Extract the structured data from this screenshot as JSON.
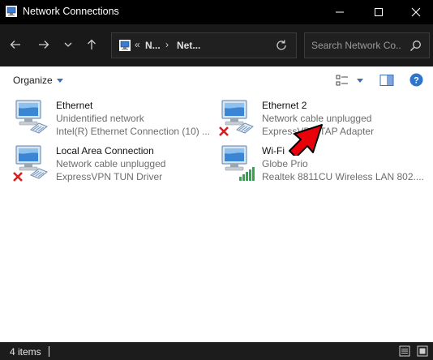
{
  "window": {
    "title": "Network Connections"
  },
  "address": {
    "crumb_overflow": "«",
    "crumbs": [
      "N...",
      "Net..."
    ],
    "separator": "›"
  },
  "search": {
    "placeholder": "Search Network Co..."
  },
  "toolbar": {
    "organize_label": "Organize"
  },
  "connections": [
    {
      "name": "Ethernet",
      "status": "Unidentified network",
      "device": "Intel(R) Ethernet Connection (10) ...",
      "state": "connected"
    },
    {
      "name": "Ethernet 2",
      "status": "Network cable unplugged",
      "device": "ExpressVPN TAP Adapter",
      "state": "disconnected"
    },
    {
      "name": "Local Area Connection",
      "status": "Network cable unplugged",
      "device": "ExpressVPN TUN Driver",
      "state": "disconnected"
    },
    {
      "name": "Wi-Fi",
      "status": "Globe Prio",
      "device": "Realtek 8811CU Wireless LAN 802....",
      "state": "wifi"
    }
  ],
  "statusbar": {
    "count_text": "4 items"
  },
  "colors": {
    "accent": "#3d6fb6",
    "error_red": "#d81e1e",
    "annotation_red": "#e8000b",
    "signal_green": "#2fa84f"
  }
}
